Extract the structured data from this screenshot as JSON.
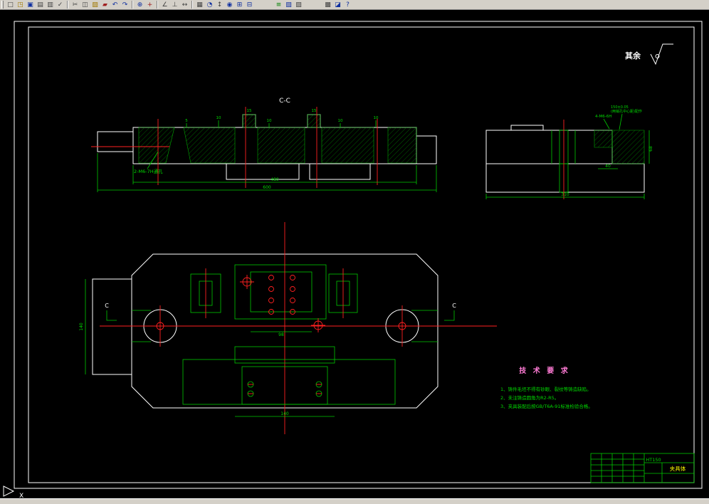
{
  "toolbar": {
    "items": [
      {
        "type": "grip"
      },
      {
        "name": "new",
        "glyph": "□",
        "color": "#404040"
      },
      {
        "name": "open",
        "glyph": "◳",
        "color": "#a07800"
      },
      {
        "name": "save",
        "glyph": "▣",
        "color": "#1030a0"
      },
      {
        "name": "print",
        "glyph": "▤",
        "color": "#404040"
      },
      {
        "name": "print-preview",
        "glyph": "▥",
        "color": "#404040"
      },
      {
        "name": "spell-check",
        "glyph": "✓",
        "color": "#404040"
      },
      {
        "type": "sep"
      },
      {
        "name": "cut",
        "glyph": "✂",
        "color": "#404040"
      },
      {
        "name": "copy",
        "glyph": "◫",
        "color": "#404040"
      },
      {
        "name": "paste",
        "glyph": "▨",
        "color": "#a07800"
      },
      {
        "name": "match-properties",
        "glyph": "▰",
        "color": "#a02020"
      },
      {
        "name": "undo",
        "glyph": "↶",
        "color": "#1030a0"
      },
      {
        "name": "redo",
        "glyph": "↷",
        "color": "#1030a0"
      },
      {
        "type": "sep"
      },
      {
        "name": "insert-hyperlink",
        "glyph": "⊕",
        "color": "#1030a0"
      },
      {
        "name": "redraw",
        "glyph": "+",
        "color": "#a02020"
      },
      {
        "type": "sep"
      },
      {
        "name": "object-snap",
        "glyph": "∠",
        "color": "#404040"
      },
      {
        "name": "ucs",
        "glyph": "⊥",
        "color": "#404040"
      },
      {
        "name": "distance",
        "glyph": "↔",
        "color": "#404040"
      },
      {
        "type": "sep"
      },
      {
        "name": "named-views",
        "glyph": "▦",
        "color": "#404040"
      },
      {
        "name": "3d-orbit",
        "glyph": "◔",
        "color": "#1030a0"
      },
      {
        "name": "pan-realtime",
        "glyph": "↕",
        "color": "#404040"
      },
      {
        "name": "zoom-realtime",
        "glyph": "◉",
        "color": "#1030a0"
      },
      {
        "name": "zoom-window",
        "glyph": "⊞",
        "color": "#1030a0"
      },
      {
        "name": "zoom-previous",
        "glyph": "⊟",
        "color": "#1030a0"
      },
      {
        "type": "gap"
      },
      {
        "name": "layers",
        "glyph": "≡",
        "color": "#008000"
      },
      {
        "name": "object-color",
        "glyph": "▧",
        "color": "#1030a0"
      },
      {
        "name": "linetype",
        "glyph": "▨",
        "color": "#404040"
      },
      {
        "type": "gap"
      },
      {
        "name": "properties",
        "glyph": "▩",
        "color": "#404040"
      },
      {
        "name": "designcenter",
        "glyph": "◪",
        "color": "#1030a0"
      },
      {
        "name": "help",
        "glyph": "?",
        "color": "#1030a0"
      }
    ]
  },
  "drawing": {
    "surface_note": {
      "label": "其余"
    },
    "section_label": "C-C",
    "cut_left": "C",
    "cut_right": "C",
    "leader_note": "2-M6-7H通孔",
    "right_view": {
      "tap_note": "4-M6-6H",
      "fit_note1": "150±0.05",
      "fit_note2": "(两销孔中心距)配作"
    },
    "dims": {
      "d1": "5",
      "d2": "10",
      "d3": "15",
      "d4": "10",
      "d5": "15",
      "d6": "10",
      "d7": "10",
      "sec_inner_len": "480",
      "sec_total_len": "600",
      "right_width": "40",
      "right_total": "310",
      "right_height": "68",
      "plan_center": "98",
      "plan_bottom": "140",
      "plan_left_h": "140"
    },
    "tech_requirements": {
      "title": "技 术 要 求",
      "items": [
        "1、铸件毛坯不得有砂眼、裂纹等铸造缺陷。",
        "2、未注铸造圆角为R2-R5。",
        "3、夹具装配后按GB/T6A-91标准检验合格。"
      ]
    },
    "title_block": {
      "material": "HT150",
      "part_name": "夹具体"
    },
    "ucs_label": "X"
  },
  "colors": {
    "line_green": "#00c800",
    "line_white": "#ffffff",
    "centerline_red": "#ff2020",
    "text_magenta": "#ff7bd5",
    "text_yellow": "#ffff00",
    "paper_bg": "#000000",
    "chrome": "#d4d0c8"
  }
}
